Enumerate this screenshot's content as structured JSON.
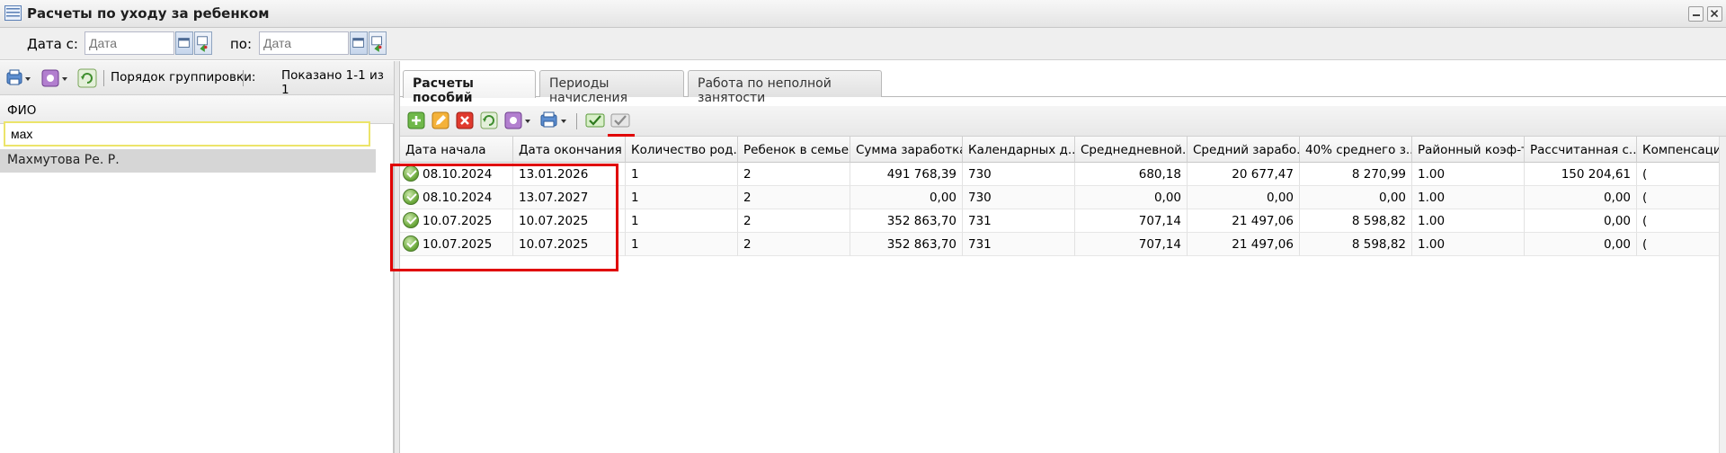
{
  "window": {
    "title": "Расчеты по уходу за ребенком"
  },
  "filter": {
    "date_from_label": "Дата с:",
    "date_from_placeholder": "Дата",
    "date_to_label": "по:",
    "date_to_placeholder": "Дата"
  },
  "left": {
    "grouping_label": "Порядок группировки:",
    "shown_label": "Показано 1-1 из 1",
    "fio_header": "ФИО",
    "fio_filter_value": "мах",
    "rows": [
      "Махмутова Ре. Р."
    ]
  },
  "tabs": [
    "Расчеты пособий",
    "Периоды начисления",
    "Работа по неполной занятости"
  ],
  "grid": {
    "columns": [
      "Дата начала",
      "Дата окончания",
      "Количество род...",
      "Ребенок в семье",
      "Сумма заработка",
      "Календарных д...",
      "Среднедневной...",
      "Средний зарабо...",
      "40% среднего з...",
      "Районный коэф-т",
      "Рассчитанная с...",
      "Компенсация"
    ],
    "rows": [
      [
        "08.10.2024",
        "13.01.2026",
        "1",
        "2",
        "491 768,39",
        "730",
        "680,18",
        "20 677,47",
        "8 270,99",
        "1.00",
        "150 204,61",
        "("
      ],
      [
        "08.10.2024",
        "13.07.2027",
        "1",
        "2",
        "0,00",
        "730",
        "0,00",
        "0,00",
        "0,00",
        "1.00",
        "0,00",
        "("
      ],
      [
        "10.07.2025",
        "10.07.2025",
        "1",
        "2",
        "352 863,70",
        "731",
        "707,14",
        "21 497,06",
        "8 598,82",
        "1.00",
        "0,00",
        "("
      ],
      [
        "10.07.2025",
        "10.07.2025",
        "1",
        "2",
        "352 863,70",
        "731",
        "707,14",
        "21 497,06",
        "8 598,82",
        "1.00",
        "0,00",
        "("
      ]
    ]
  },
  "colors": {
    "highlight": "#e00000",
    "accent": "#6aa83a"
  }
}
